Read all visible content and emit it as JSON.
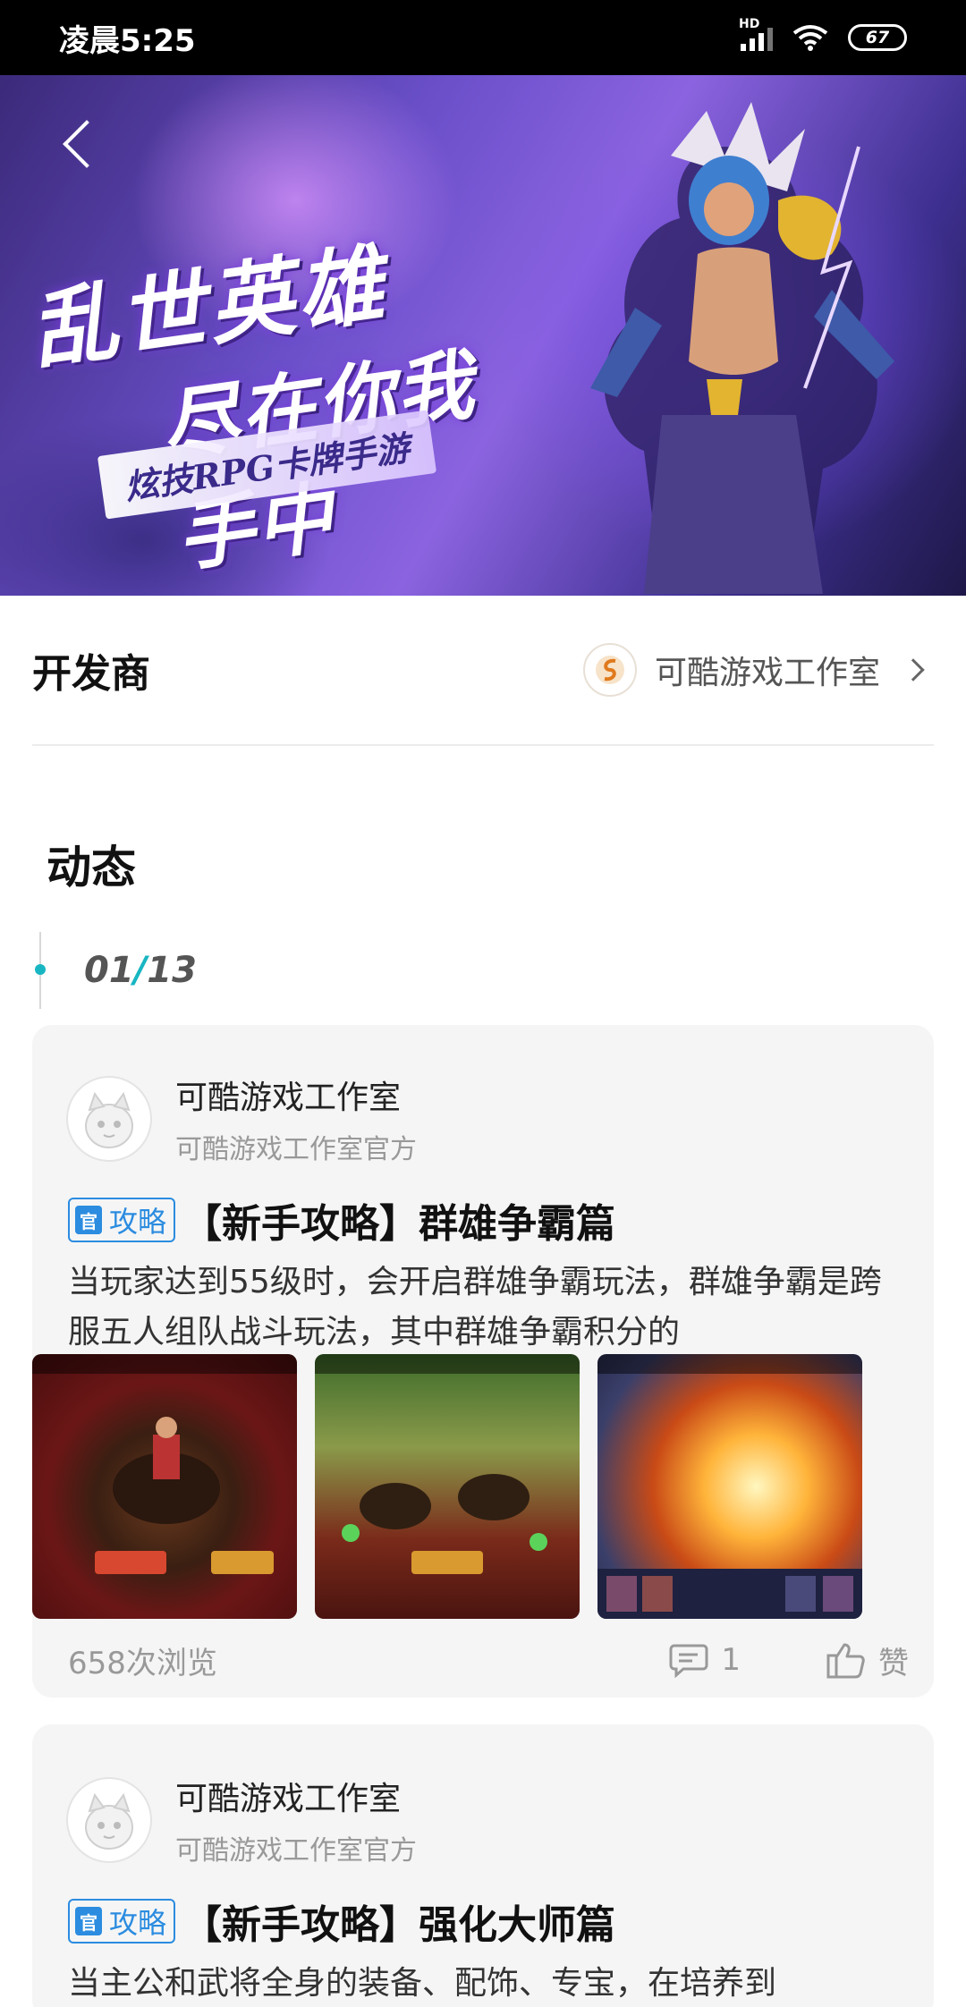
{
  "status_bar": {
    "time": "凌晨5:25",
    "network_badge": "HD",
    "battery": "67"
  },
  "hero": {
    "line1": "乱世英雄",
    "line2": "尽在你我手中",
    "tagline": "炫技RPG卡牌手游"
  },
  "developer": {
    "label": "开发商",
    "name": "可酷游戏工作室"
  },
  "section": {
    "title": "动态"
  },
  "pager": {
    "current": "01",
    "separator": "/",
    "total": "13"
  },
  "posts": [
    {
      "author": "可酷游戏工作室",
      "author_sub": "可酷游戏工作室官方",
      "badge_icon": "官",
      "badge": "攻略",
      "title": "【新手攻略】群雄争霸篇",
      "body": "当玩家达到55级时，会开启群雄争霸玩法，群雄争霸是跨服五人组队战斗玩法，其中群雄争霸积分的",
      "views": "658次浏览",
      "comments": "1",
      "like": "赞"
    },
    {
      "author": "可酷游戏工作室",
      "author_sub": "可酷游戏工作室官方",
      "badge_icon": "官",
      "badge": "攻略",
      "title": "【新手攻略】强化大师篇",
      "body": "当主公和武将全身的装备、配饰、专宝，在培养到"
    }
  ],
  "colors": {
    "accent": "#18b6c2",
    "badge_blue": "#2b8ce0",
    "card_bg": "#f5f5f5"
  },
  "icons": [
    "back-icon",
    "chevron-right-icon",
    "comment-icon",
    "thumbs-up-icon",
    "wifi-icon",
    "signal-icon",
    "battery-icon"
  ]
}
